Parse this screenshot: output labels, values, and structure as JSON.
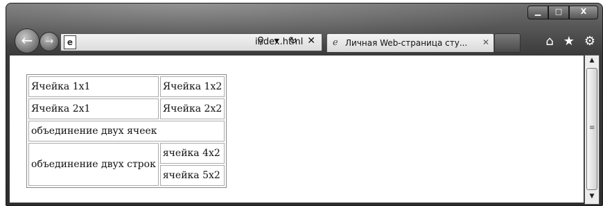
{
  "browser": {
    "address_url": "index.html",
    "address_tools": "⚲ ▾ ↻ ✕",
    "tab_title": "Личная Web-страница сту...",
    "tab_close": "✕",
    "window_buttons": {
      "minimize": "▁",
      "maximize": "□",
      "close": "X"
    },
    "toolbar_icons": {
      "home": "⌂",
      "favorites": "★",
      "tools": "⚙"
    }
  },
  "table": {
    "rows": [
      {
        "c1": "Ячейка 1x1",
        "c2": "Ячейка 1x2"
      },
      {
        "c1": "Ячейка 2x1",
        "c2": "Ячейка 2x2"
      },
      {
        "merged_cols": "объединение двух ячеек"
      },
      {
        "merged_rows": "объединение двух строк",
        "c2": "ячейка 4x2"
      },
      {
        "c2": "ячейка 5x2"
      }
    ]
  }
}
